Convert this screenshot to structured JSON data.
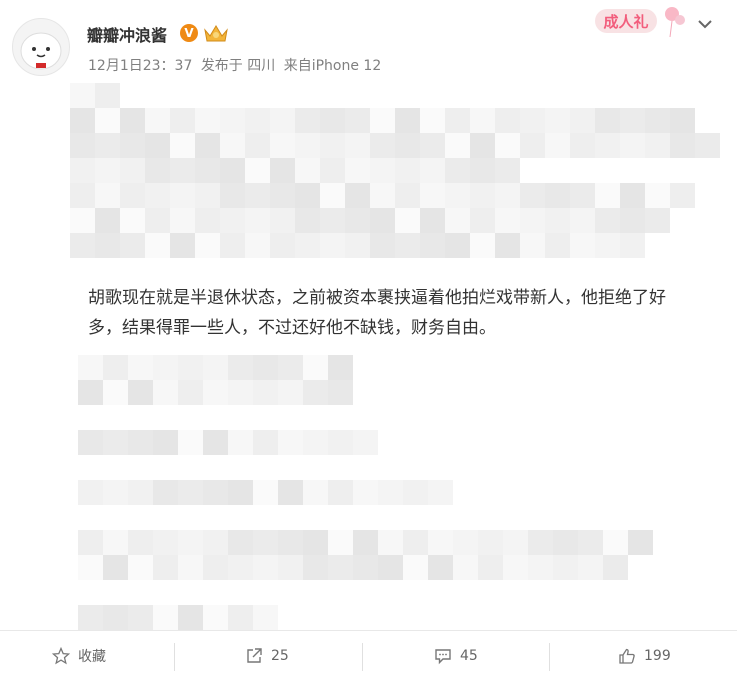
{
  "header": {
    "username": "瓣瓣冲浪酱",
    "verified_badge": "V",
    "time": "12月1日23：37",
    "location": "发布于 四川",
    "device": "来自iPhone 12",
    "promo_label": "成人礼"
  },
  "post": {
    "text_line1": "胡歌现在就是半退休状态，之前被资本裹挟逼着他拍烂戏带新人，他拒绝了好",
    "text_line2": "多，结果得罪一些人，不过还好他不缺钱，财务自由。"
  },
  "footer": {
    "favorite_label": "收藏",
    "repost_count": "25",
    "comment_count": "45",
    "like_count": "199"
  },
  "colors": {
    "badge": "#ef8a14",
    "text": "#333333",
    "meta": "#808080",
    "blur_light": "#f5f5f5",
    "blur_dark": "#e2e2e2"
  }
}
